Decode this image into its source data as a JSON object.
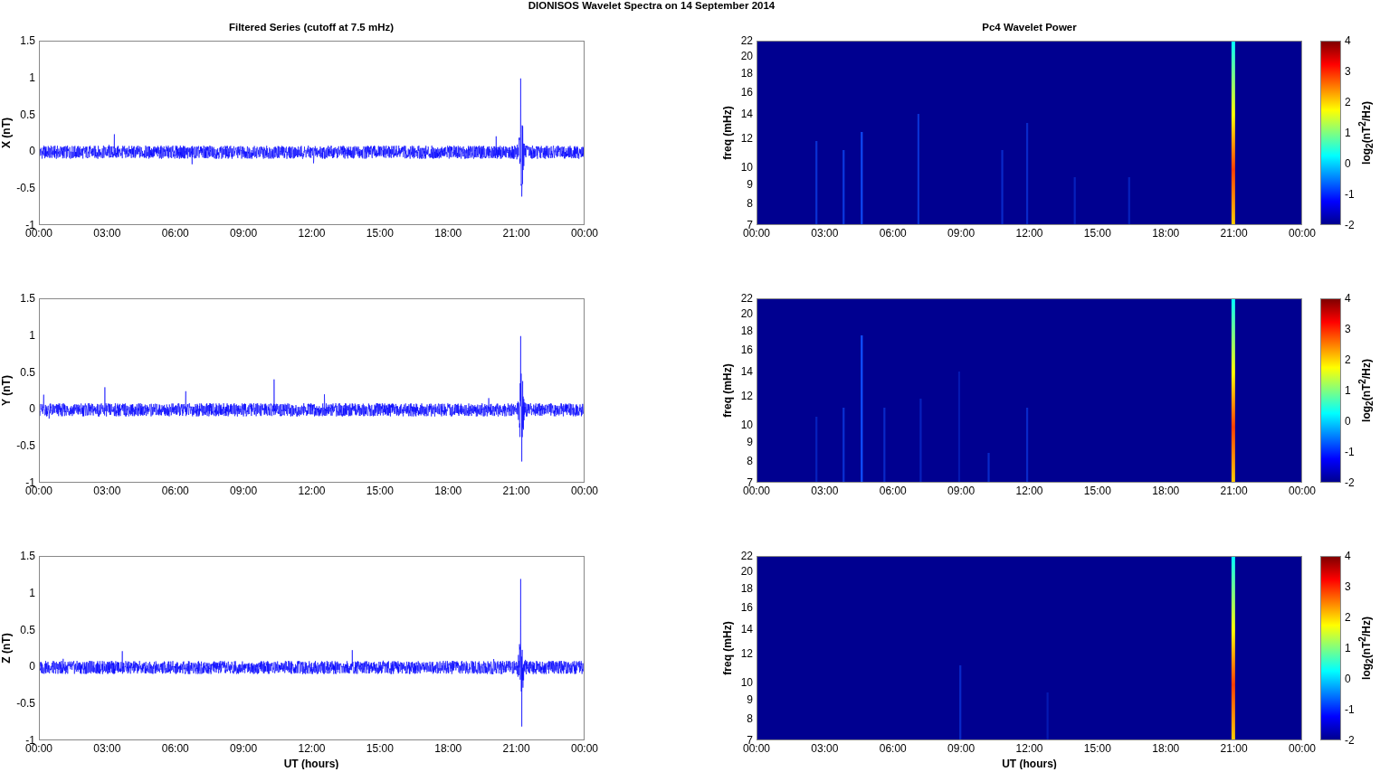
{
  "figure": {
    "title": "DIONISOS Wavelet Spectra on 14 September 2014"
  },
  "left_column": {
    "title": "Filtered Series (cutoff at 7.5 mHz)",
    "xlabel": "UT (hours)",
    "panels": [
      {
        "ylabel": "X (nT)",
        "yticks": [
          "1.5",
          "1",
          "0.5",
          "0",
          "-0.5",
          "-1"
        ],
        "xticks": [
          "00:00",
          "03:00",
          "06:00",
          "09:00",
          "12:00",
          "15:00",
          "18:00",
          "21:00",
          "00:00"
        ]
      },
      {
        "ylabel": "Y (nT)",
        "yticks": [
          "1.5",
          "1",
          "0.5",
          "0",
          "-0.5",
          "-1"
        ],
        "xticks": [
          "00:00",
          "03:00",
          "06:00",
          "09:00",
          "12:00",
          "15:00",
          "18:00",
          "21:00",
          "00:00"
        ]
      },
      {
        "ylabel": "Z (nT)",
        "yticks": [
          "1.5",
          "1",
          "0.5",
          "0",
          "-0.5",
          "-1"
        ],
        "xticks": [
          "00:00",
          "03:00",
          "06:00",
          "09:00",
          "12:00",
          "15:00",
          "18:00",
          "21:00",
          "00:00"
        ]
      }
    ]
  },
  "right_column": {
    "title": "Pc4 Wavelet Power",
    "xlabel": "UT (hours)",
    "panels": [
      {
        "ylabel": "freq (mHz)",
        "yticks": [
          "22",
          "20",
          "18",
          "16",
          "14",
          "12",
          "10",
          "9",
          "8",
          "7"
        ],
        "xticks": [
          "00:00",
          "03:00",
          "06:00",
          "09:00",
          "12:00",
          "15:00",
          "18:00",
          "21:00",
          "00:00"
        ],
        "colorbar": {
          "label": "log$_{2}$(nT$^{2}$/Hz)",
          "ticks": [
            "4",
            "3",
            "2",
            "1",
            "0",
            "-1",
            "-2"
          ]
        }
      },
      {
        "ylabel": "freq (mHz)",
        "yticks": [
          "22",
          "20",
          "18",
          "16",
          "14",
          "12",
          "10",
          "9",
          "8",
          "7"
        ],
        "xticks": [
          "00:00",
          "03:00",
          "06:00",
          "09:00",
          "12:00",
          "15:00",
          "18:00",
          "21:00",
          "00:00"
        ],
        "colorbar": {
          "label": "log$_{2}$(nT$^{2}$/Hz)",
          "ticks": [
            "4",
            "3",
            "2",
            "1",
            "0",
            "-1",
            "-2"
          ]
        }
      },
      {
        "ylabel": "freq (mHz)",
        "yticks": [
          "22",
          "20",
          "18",
          "16",
          "14",
          "12",
          "10",
          "9",
          "8",
          "7"
        ],
        "xticks": [
          "00:00",
          "03:00",
          "06:00",
          "09:00",
          "12:00",
          "15:00",
          "18:00",
          "21:00",
          "00:00"
        ],
        "colorbar": {
          "label": "log$_{2}$(nT$^{2}$/Hz)",
          "ticks": [
            "4",
            "3",
            "2",
            "1",
            "0",
            "-1",
            "-2"
          ]
        }
      }
    ]
  }
}
